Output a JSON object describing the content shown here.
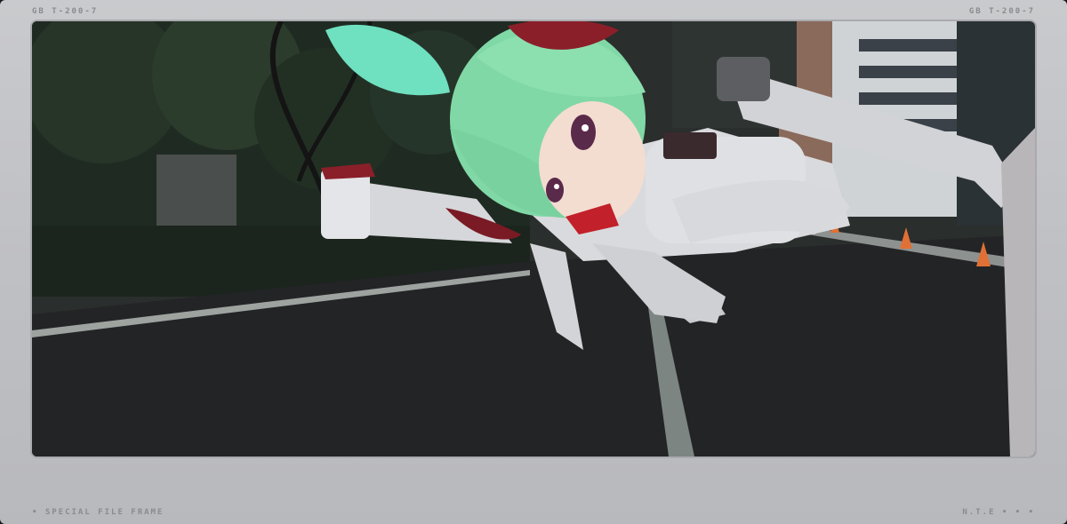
{
  "frame": {
    "top_left_label": "GB   T-200-7",
    "top_right_label": "GB   T-200-7",
    "bottom_left_label": "• SPECIAL FILE FRAME",
    "bottom_right_label": "N.T.E • • •"
  },
  "colors": {
    "frame": "#c4c5c9",
    "hair": "#7fd9a8",
    "horn": "#8a1f2a",
    "outfit": "#d9dadd",
    "road": "#232426",
    "foliage": "#263527"
  },
  "scene": {
    "icon": "character-screenshot"
  }
}
